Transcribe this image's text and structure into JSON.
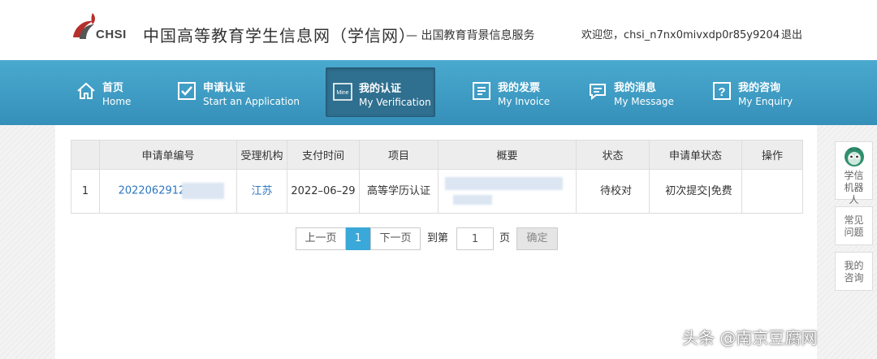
{
  "header": {
    "logo_text": "CHSI",
    "title": "中国高等教育学生信息网（学信网）",
    "subtitle": "— 出国教育背景信息服务",
    "welcome": "欢迎您，chsi_n7nx0mivxdp0r85y9204",
    "logout": "退出"
  },
  "nav": [
    {
      "zh": "首页",
      "en": "Home",
      "icon": "home-icon"
    },
    {
      "zh": "申请认证",
      "en": "Start an Application",
      "icon": "check-box-icon"
    },
    {
      "zh": "我的认证",
      "en": "My Verification",
      "icon": "mine-icon",
      "icon_text": "Mine",
      "active": true
    },
    {
      "zh": "我的发票",
      "en": "My Invoice",
      "icon": "invoice-icon"
    },
    {
      "zh": "我的消息",
      "en": "My Message",
      "icon": "message-icon"
    },
    {
      "zh": "我的咨询",
      "en": "My Enquiry",
      "icon": "question-icon",
      "icon_text": "?"
    }
  ],
  "table": {
    "columns": [
      "",
      "申请单编号",
      "受理机构",
      "支付时间",
      "项目",
      "概要",
      "状态",
      "申请单状态",
      "操作"
    ],
    "rows": [
      {
        "index": "1",
        "number": "2022062912",
        "agency": "江苏",
        "paid_date": "2022–06–29",
        "project": "高等学历认证",
        "summary": "",
        "status": "待校对",
        "order_status": "初次提交|免费",
        "action": ""
      }
    ]
  },
  "pager": {
    "prev": "上一页",
    "current": "1",
    "next": "下一页",
    "goto_prefix": "到第",
    "goto_value": "1",
    "goto_suffix": "页",
    "confirm": "确定"
  },
  "side": {
    "robot": "学信机器人",
    "faq": "常见问题",
    "enquiry": "我的咨询"
  },
  "watermark": "头条 @南京豆腐网"
}
